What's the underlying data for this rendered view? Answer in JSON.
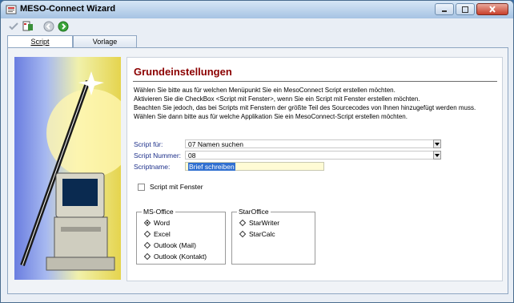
{
  "window": {
    "title": "MESO-Connect Wizard"
  },
  "toolbar": {
    "icons": [
      "checkmark-icon",
      "script-icon",
      "back-icon",
      "forward-icon"
    ]
  },
  "tabs": [
    {
      "label": "Script",
      "active": true
    },
    {
      "label": "Vorlage",
      "active": false
    }
  ],
  "panel": {
    "heading": "Grundeinstellungen",
    "description": [
      "Wählen Sie bitte aus für welchen Menüpunkt Sie ein MesoConnect Script erstellen möchten.",
      "Aktivieren Sie die CheckBox <Script mit Fenster>, wenn Sie ein Script mit Fenster erstellen möchten.",
      "Beachten Sie jedoch, das bei Scripts mit Fenstern der größte Teil des Sourcecodes von Ihnen hinzugefügt werden muss.",
      "Wählen Sie dann bitte aus für welche Applikation Sie ein MesoConnect-Script erstellen möchten."
    ],
    "script_fuer": {
      "label": "Script für:",
      "value": "07  Namen suchen"
    },
    "script_nummer": {
      "label": "Script Nummer:",
      "value": "08"
    },
    "scriptname": {
      "label": "Scriptname:",
      "value": "Brief schreiben"
    },
    "script_mit_fenster": {
      "label": "Script mit Fenster",
      "checked": false
    },
    "ms_office": {
      "label": "MS-Office",
      "options": [
        "Word",
        "Excel",
        "Outlook (Mail)",
        "Outlook (Kontakt)"
      ],
      "selected": "Word"
    },
    "star_office": {
      "label": "StarOffice",
      "options": [
        "StarWriter",
        "StarCalc"
      ],
      "selected": null
    }
  },
  "colors": {
    "heading": "#8b0000",
    "label_blue": "#1c2f8a",
    "selection": "#2f6fd0"
  }
}
